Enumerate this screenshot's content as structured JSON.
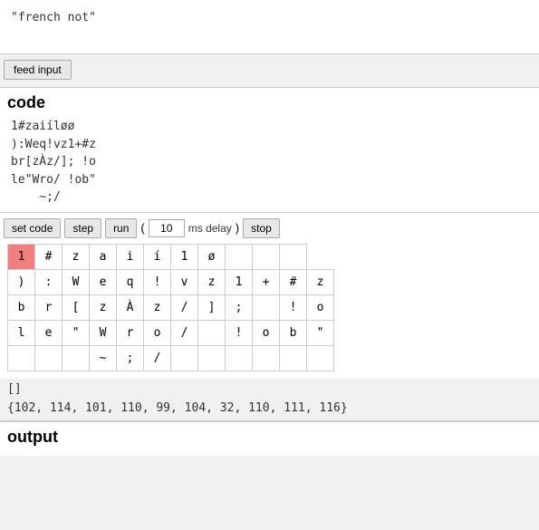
{
  "top": {
    "input_text": "\"french not\""
  },
  "feed_button": {
    "label": "feed input"
  },
  "code_section": {
    "title": "code",
    "lines": [
      "1#zaiíløø",
      "):Weq!vz1+#z",
      "br[zÀz/]; !o",
      "le\"Wro/ !ob\"",
      "    ~;/"
    ]
  },
  "toolbar": {
    "set_code_label": "set code",
    "step_label": "step",
    "run_label": "run",
    "delay_value": "10",
    "ms_delay_label": "ms delay",
    "stop_label": "stop"
  },
  "grid": {
    "rows": [
      [
        "1",
        "#",
        "z",
        "a",
        "i",
        "í",
        "1",
        "ø",
        "",
        "",
        ""
      ],
      [
        ")",
        ":",
        "W",
        "e",
        "q",
        "!",
        "v",
        "z",
        "1",
        "+",
        "#",
        "z"
      ],
      [
        "b",
        "r",
        "[",
        "z",
        "À",
        "z",
        "/",
        "]",
        ";",
        "",
        "!",
        "o"
      ],
      [
        "l",
        "e",
        "\"",
        "W",
        "r",
        "o",
        "/",
        "",
        "!",
        "o",
        "b",
        "\""
      ],
      [
        "",
        "",
        "",
        "~",
        ";",
        "/",
        "",
        "",
        "",
        "",
        "",
        ""
      ]
    ],
    "highlight": {
      "row": 0,
      "col": 0
    }
  },
  "stack": {
    "value": "[]"
  },
  "bytes": {
    "value": "{102, 114, 101, 110, 99, 104, 32, 110, 111, 116}"
  },
  "output_section": {
    "title": "output"
  }
}
